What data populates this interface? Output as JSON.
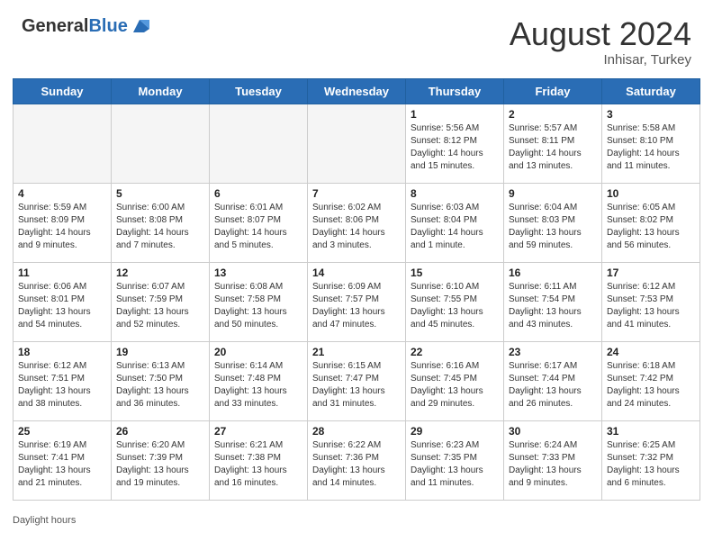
{
  "header": {
    "logo_general": "General",
    "logo_blue": "Blue",
    "month_year": "August 2024",
    "location": "Inhisar, Turkey"
  },
  "days_of_week": [
    "Sunday",
    "Monday",
    "Tuesday",
    "Wednesday",
    "Thursday",
    "Friday",
    "Saturday"
  ],
  "weeks": [
    [
      {
        "day": "",
        "info": ""
      },
      {
        "day": "",
        "info": ""
      },
      {
        "day": "",
        "info": ""
      },
      {
        "day": "",
        "info": ""
      },
      {
        "day": "1",
        "info": "Sunrise: 5:56 AM\nSunset: 8:12 PM\nDaylight: 14 hours and 15 minutes."
      },
      {
        "day": "2",
        "info": "Sunrise: 5:57 AM\nSunset: 8:11 PM\nDaylight: 14 hours and 13 minutes."
      },
      {
        "day": "3",
        "info": "Sunrise: 5:58 AM\nSunset: 8:10 PM\nDaylight: 14 hours and 11 minutes."
      }
    ],
    [
      {
        "day": "4",
        "info": "Sunrise: 5:59 AM\nSunset: 8:09 PM\nDaylight: 14 hours and 9 minutes."
      },
      {
        "day": "5",
        "info": "Sunrise: 6:00 AM\nSunset: 8:08 PM\nDaylight: 14 hours and 7 minutes."
      },
      {
        "day": "6",
        "info": "Sunrise: 6:01 AM\nSunset: 8:07 PM\nDaylight: 14 hours and 5 minutes."
      },
      {
        "day": "7",
        "info": "Sunrise: 6:02 AM\nSunset: 8:06 PM\nDaylight: 14 hours and 3 minutes."
      },
      {
        "day": "8",
        "info": "Sunrise: 6:03 AM\nSunset: 8:04 PM\nDaylight: 14 hours and 1 minute."
      },
      {
        "day": "9",
        "info": "Sunrise: 6:04 AM\nSunset: 8:03 PM\nDaylight: 13 hours and 59 minutes."
      },
      {
        "day": "10",
        "info": "Sunrise: 6:05 AM\nSunset: 8:02 PM\nDaylight: 13 hours and 56 minutes."
      }
    ],
    [
      {
        "day": "11",
        "info": "Sunrise: 6:06 AM\nSunset: 8:01 PM\nDaylight: 13 hours and 54 minutes."
      },
      {
        "day": "12",
        "info": "Sunrise: 6:07 AM\nSunset: 7:59 PM\nDaylight: 13 hours and 52 minutes."
      },
      {
        "day": "13",
        "info": "Sunrise: 6:08 AM\nSunset: 7:58 PM\nDaylight: 13 hours and 50 minutes."
      },
      {
        "day": "14",
        "info": "Sunrise: 6:09 AM\nSunset: 7:57 PM\nDaylight: 13 hours and 47 minutes."
      },
      {
        "day": "15",
        "info": "Sunrise: 6:10 AM\nSunset: 7:55 PM\nDaylight: 13 hours and 45 minutes."
      },
      {
        "day": "16",
        "info": "Sunrise: 6:11 AM\nSunset: 7:54 PM\nDaylight: 13 hours and 43 minutes."
      },
      {
        "day": "17",
        "info": "Sunrise: 6:12 AM\nSunset: 7:53 PM\nDaylight: 13 hours and 41 minutes."
      }
    ],
    [
      {
        "day": "18",
        "info": "Sunrise: 6:12 AM\nSunset: 7:51 PM\nDaylight: 13 hours and 38 minutes."
      },
      {
        "day": "19",
        "info": "Sunrise: 6:13 AM\nSunset: 7:50 PM\nDaylight: 13 hours and 36 minutes."
      },
      {
        "day": "20",
        "info": "Sunrise: 6:14 AM\nSunset: 7:48 PM\nDaylight: 13 hours and 33 minutes."
      },
      {
        "day": "21",
        "info": "Sunrise: 6:15 AM\nSunset: 7:47 PM\nDaylight: 13 hours and 31 minutes."
      },
      {
        "day": "22",
        "info": "Sunrise: 6:16 AM\nSunset: 7:45 PM\nDaylight: 13 hours and 29 minutes."
      },
      {
        "day": "23",
        "info": "Sunrise: 6:17 AM\nSunset: 7:44 PM\nDaylight: 13 hours and 26 minutes."
      },
      {
        "day": "24",
        "info": "Sunrise: 6:18 AM\nSunset: 7:42 PM\nDaylight: 13 hours and 24 minutes."
      }
    ],
    [
      {
        "day": "25",
        "info": "Sunrise: 6:19 AM\nSunset: 7:41 PM\nDaylight: 13 hours and 21 minutes."
      },
      {
        "day": "26",
        "info": "Sunrise: 6:20 AM\nSunset: 7:39 PM\nDaylight: 13 hours and 19 minutes."
      },
      {
        "day": "27",
        "info": "Sunrise: 6:21 AM\nSunset: 7:38 PM\nDaylight: 13 hours and 16 minutes."
      },
      {
        "day": "28",
        "info": "Sunrise: 6:22 AM\nSunset: 7:36 PM\nDaylight: 13 hours and 14 minutes."
      },
      {
        "day": "29",
        "info": "Sunrise: 6:23 AM\nSunset: 7:35 PM\nDaylight: 13 hours and 11 minutes."
      },
      {
        "day": "30",
        "info": "Sunrise: 6:24 AM\nSunset: 7:33 PM\nDaylight: 13 hours and 9 minutes."
      },
      {
        "day": "31",
        "info": "Sunrise: 6:25 AM\nSunset: 7:32 PM\nDaylight: 13 hours and 6 minutes."
      }
    ]
  ],
  "footer": {
    "daylight_label": "Daylight hours"
  }
}
